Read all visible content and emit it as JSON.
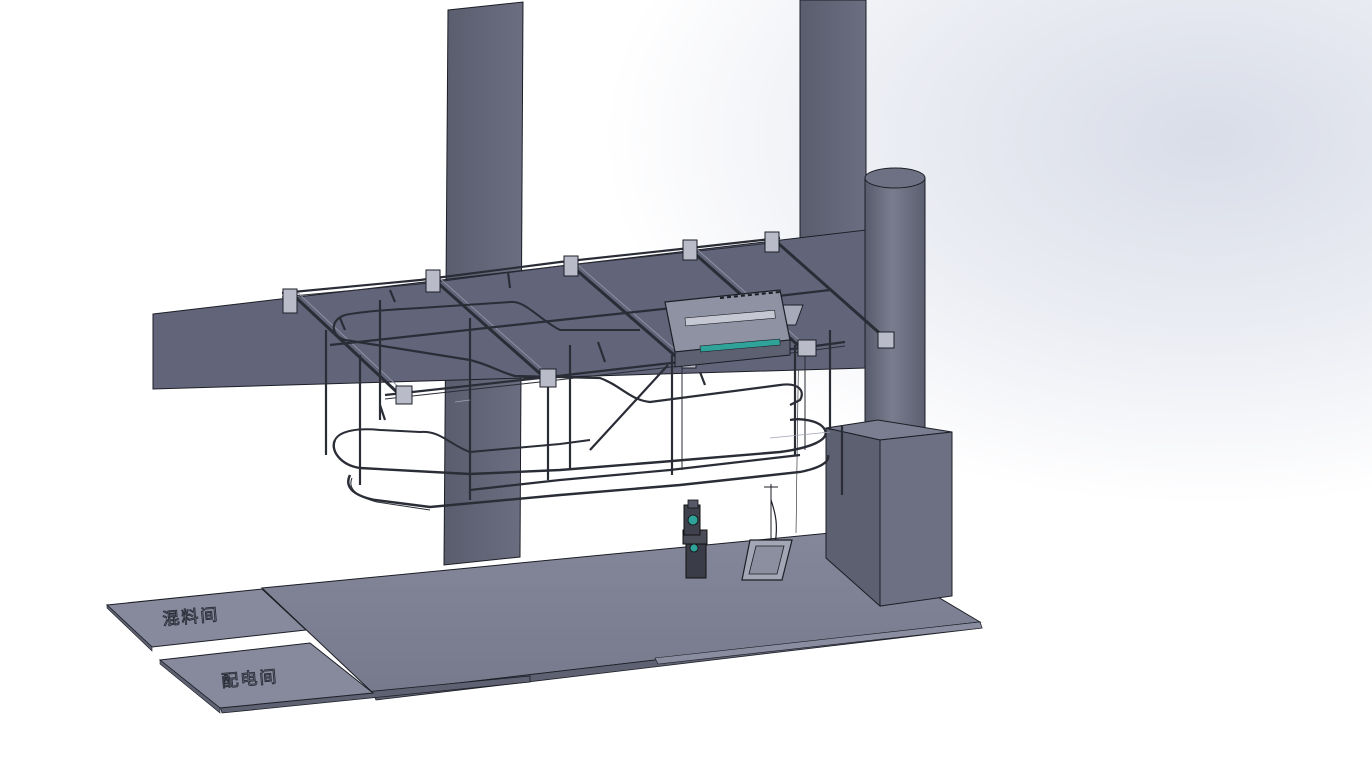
{
  "scene": {
    "type": "3d-cad-model-view",
    "background": "#ffffff",
    "model_color": "#6b6e80",
    "edge_color": "#1c1e26",
    "floor_color": "#7e8193",
    "accent_color": "#2fa39a"
  },
  "labels": {
    "room_1": "混料间",
    "room_2": "配电间"
  }
}
